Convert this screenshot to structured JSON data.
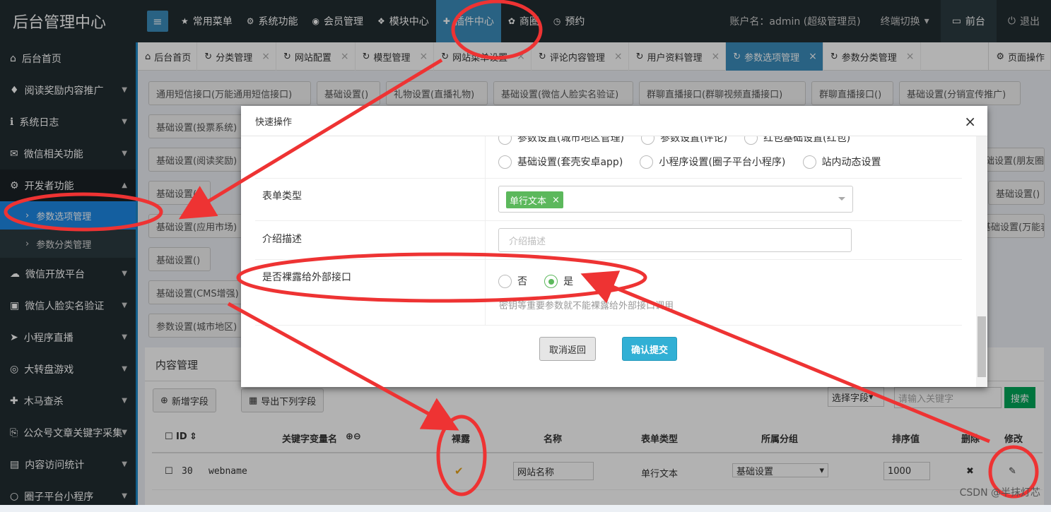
{
  "brand": "后台管理中心",
  "topnav": [
    {
      "icon": "★",
      "label": "常用菜单"
    },
    {
      "icon": "⚙",
      "label": "系统功能"
    },
    {
      "icon": "◉",
      "label": "会员管理"
    },
    {
      "icon": "❖",
      "label": "模块中心"
    },
    {
      "icon": "✚",
      "label": "插件中心"
    },
    {
      "icon": "✿",
      "label": "商圈"
    },
    {
      "icon": "◷",
      "label": "预约"
    }
  ],
  "account": "账户名：admin (超级管理员)",
  "terminal": "终端切换",
  "front": "前台",
  "logout": "退出",
  "sidebar": {
    "items": [
      {
        "icon": "⌂",
        "label": "后台首页"
      },
      {
        "icon": "♦",
        "label": "阅读奖励内容推广"
      },
      {
        "icon": "ℹ",
        "label": "系统日志"
      },
      {
        "icon": "✉",
        "label": "微信相关功能"
      },
      {
        "icon": "⚙",
        "label": "开发者功能"
      }
    ],
    "subs": [
      {
        "label": "参数选项管理"
      },
      {
        "label": "参数分类管理"
      }
    ],
    "more": [
      {
        "icon": "☁",
        "label": "微信开放平台"
      },
      {
        "icon": "▣",
        "label": "微信人脸实名验证"
      },
      {
        "icon": "➤",
        "label": "小程序直播"
      },
      {
        "icon": "◎",
        "label": "大转盘游戏"
      },
      {
        "icon": "✚",
        "label": "木马查杀"
      },
      {
        "icon": "⎘",
        "label": "公众号文章关键字采集"
      },
      {
        "icon": "▤",
        "label": "内容访问统计"
      },
      {
        "icon": "○",
        "label": "圈子平台小程序"
      }
    ]
  },
  "tabs": [
    {
      "label": "后台首页"
    },
    {
      "label": "分类管理"
    },
    {
      "label": "网站配置"
    },
    {
      "label": "模型管理"
    },
    {
      "label": "网站菜单设置"
    },
    {
      "label": "评论内容管理"
    },
    {
      "label": "用户资料管理"
    },
    {
      "label": "参数选项管理"
    },
    {
      "label": "参数分类管理"
    }
  ],
  "page_ops": "页面操作",
  "bg_buttons": [
    "通用短信接口(万能通用短信接口)",
    "基础设置()",
    "礼物设置(直播礼物)",
    "基础设置(微信人脸实名验证)",
    "群聊直播接口(群聊视频直播接口)",
    "群聊直播接口()",
    "基础设置(分销宣传推广)",
    "基础设置(投票系统)",
    "基础设置(阅读奖励)",
    "基础设置(朋友圈)",
    "基础设置()",
    "基础设置()",
    "基础设置(应用市场)",
    "基础设置(万能表单)",
    "基础设置()",
    "基础设置(CMS增强)",
    "参数设置(城市地区)"
  ],
  "box": {
    "tab": "内容管理",
    "add_field": "新增字段",
    "export": "导出下列字段",
    "select_field": "选择字段",
    "search_placeholder": "请输入关键字",
    "search": "搜索"
  },
  "table": {
    "headers": [
      "ID",
      "关键字变量名",
      "裸露",
      "名称",
      "表单类型",
      "所属分组",
      "排序值",
      "删除",
      "修改"
    ],
    "row": {
      "id": "30",
      "key": "webname",
      "name": "网站名称",
      "type": "单行文本",
      "group": "基础设置",
      "sort": "1000"
    }
  },
  "modal": {
    "title": "快速操作",
    "radio_top": [
      "参数设置(城市地区管理)",
      "参数设置(评论)",
      "红包基础设置(红包)"
    ],
    "radio_row": [
      "基础设置(套壳安卓app)",
      "小程序设置(圈子平台小程序)",
      "站内动态设置"
    ],
    "form_type_label": "表单类型",
    "form_type_value": "单行文本",
    "desc_label": "介绍描述",
    "desc_placeholder": "介绍描述",
    "expose_label": "是否裸露给外部接口",
    "no": "否",
    "yes": "是",
    "expose_hint": "密钥等重要参数就不能裸露给外部接口调用",
    "cancel": "取消返回",
    "submit": "确认提交"
  },
  "watermark": "CSDN @半抹灯芯",
  "colors": {
    "annotation": "#ee3333",
    "primary": "#3c8dbc",
    "success": "#5cb85c",
    "dark": "#222d32"
  }
}
